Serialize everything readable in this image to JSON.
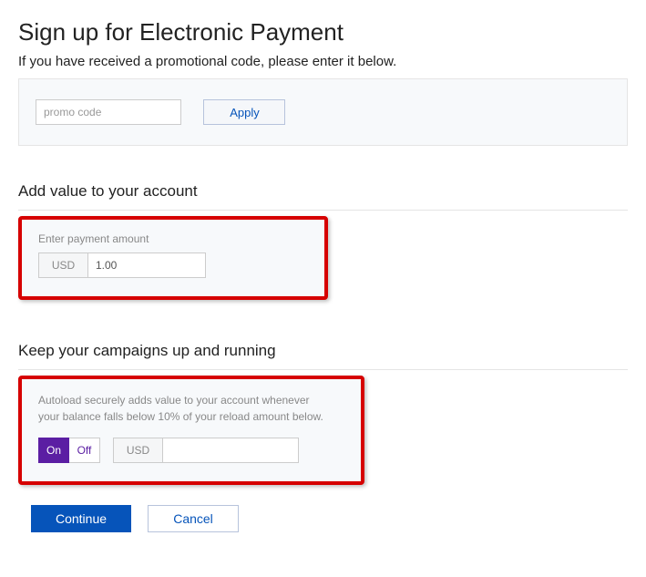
{
  "header": {
    "title": "Sign up for Electronic Payment",
    "subtitle": "If you have received a promotional code, please enter it below."
  },
  "promo": {
    "placeholder": "promo code",
    "apply_label": "Apply"
  },
  "payment": {
    "heading": "Add value to your account",
    "field_label": "Enter payment amount",
    "currency": "USD",
    "amount": "1.00"
  },
  "autoload": {
    "heading": "Keep your campaigns up and running",
    "description_line1": "Autoload securely adds value to your account whenever",
    "description_line2": "your balance falls below 10% of your reload amount below.",
    "on_label": "On",
    "off_label": "Off",
    "currency": "USD",
    "reload_amount": ""
  },
  "actions": {
    "continue_label": "Continue",
    "cancel_label": "Cancel"
  }
}
